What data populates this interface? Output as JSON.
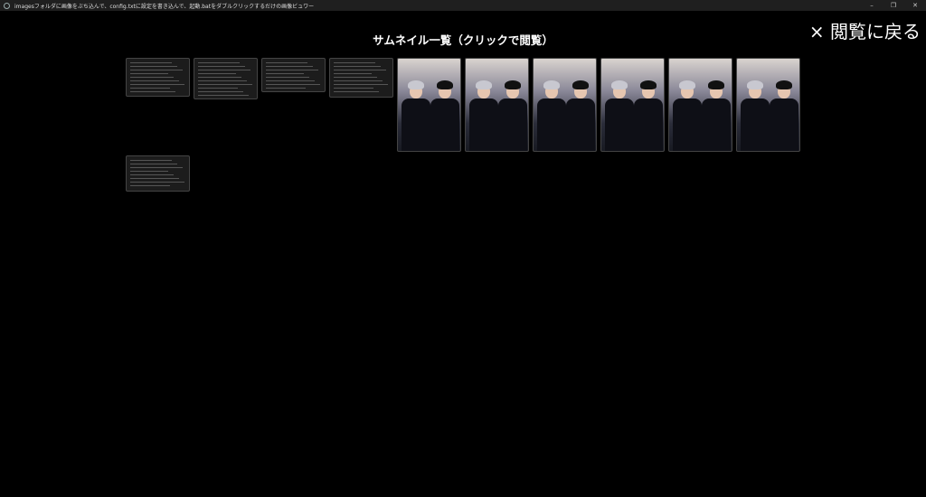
{
  "window": {
    "title": "imagesフォルダに画像をぶち込んで、config.txtに設定を書き込んで、起動.batをダブルクリックするだけの画像ビュワー",
    "minimize": "–",
    "restore": "❐",
    "close": "✕"
  },
  "close_view_label": "× 閲覧に戻る",
  "heading": "サムネイル一覧（クリックで閲覧）",
  "thumbnails": [
    {
      "kind": "screenshot",
      "name": "explorer-list"
    },
    {
      "kind": "screenshot",
      "name": "thumbnail-grid"
    },
    {
      "kind": "screenshot",
      "name": "editor"
    },
    {
      "kind": "screenshot",
      "name": "explorer-list-2"
    },
    {
      "kind": "photo",
      "name": "photo-1"
    },
    {
      "kind": "photo",
      "name": "photo-2"
    },
    {
      "kind": "photo",
      "name": "photo-3"
    },
    {
      "kind": "photo",
      "name": "photo-4"
    },
    {
      "kind": "photo",
      "name": "photo-5"
    },
    {
      "kind": "photo",
      "name": "photo-6"
    },
    {
      "kind": "screenshot",
      "name": "message-dialog"
    }
  ],
  "colors": {
    "background": "#000000",
    "titlebar": "#1f1f1f",
    "hair_light": "#c8c8d0",
    "hair_dark": "#111111"
  }
}
